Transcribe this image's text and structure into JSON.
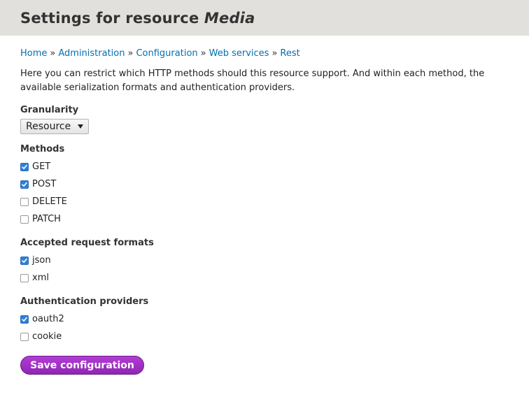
{
  "header": {
    "title_prefix": "Settings for resource ",
    "title_resource": "Media"
  },
  "breadcrumb": [
    {
      "label": "Home"
    },
    {
      "label": "Administration"
    },
    {
      "label": "Configuration"
    },
    {
      "label": "Web services"
    },
    {
      "label": "Rest"
    }
  ],
  "breadcrumb_separator": "»",
  "description": "Here you can restrict which HTTP methods should this resource support. And within each method, the available serialization formats and authentication providers.",
  "granularity": {
    "label": "Granularity",
    "selected": "Resource"
  },
  "methods": {
    "label": "Methods",
    "items": [
      {
        "label": "GET",
        "checked": true
      },
      {
        "label": "POST",
        "checked": true
      },
      {
        "label": "DELETE",
        "checked": false
      },
      {
        "label": "PATCH",
        "checked": false
      }
    ]
  },
  "formats": {
    "label": "Accepted request formats",
    "items": [
      {
        "label": "json",
        "checked": true
      },
      {
        "label": "xml",
        "checked": false
      }
    ]
  },
  "auth": {
    "label": "Authentication providers",
    "items": [
      {
        "label": "oauth2",
        "checked": true
      },
      {
        "label": "cookie",
        "checked": false
      }
    ]
  },
  "actions": {
    "save_label": "Save configuration"
  },
  "colors": {
    "header_bg": "#e2e0dc",
    "link": "#0071b3",
    "checkbox_checked": "#2f7fd8",
    "button": "#a032c7"
  }
}
